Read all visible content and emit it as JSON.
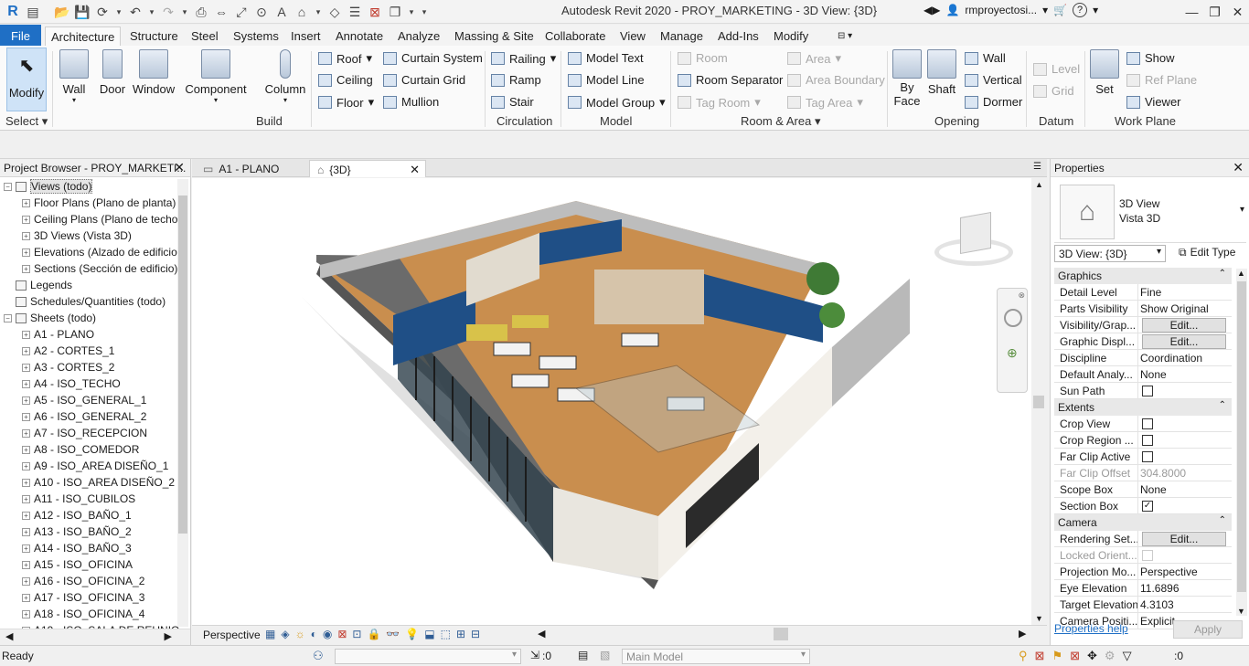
{
  "app": {
    "title": "Autodesk Revit 2020 - PROY_MARKETING - 3D View: {3D}",
    "user": "rmproyectosi...",
    "help": "?"
  },
  "ribbon_tabs": [
    "File",
    "Architecture",
    "Structure",
    "Steel",
    "Systems",
    "Insert",
    "Annotate",
    "Analyze",
    "Massing & Site",
    "Collaborate",
    "View",
    "Manage",
    "Add-Ins",
    "Modify"
  ],
  "ribbon": {
    "modify": "Modify",
    "select": "Select",
    "build": {
      "label": "Build",
      "wall": "Wall",
      "door": "Door",
      "window": "Window",
      "component": "Component",
      "column": "Column",
      "roof": "Roof",
      "ceiling": "Ceiling",
      "floor": "Floor",
      "curtain_system": "Curtain System",
      "curtain_grid": "Curtain Grid",
      "mullion": "Mullion"
    },
    "circulation": {
      "label": "Circulation",
      "railing": "Railing",
      "ramp": "Ramp",
      "stair": "Stair"
    },
    "model": {
      "label": "Model",
      "model_text": "Model Text",
      "model_line": "Model Line",
      "model_group": "Model Group"
    },
    "room_area": {
      "label": "Room & Area",
      "room": "Room",
      "room_separator": "Room Separator",
      "tag_room": "Tag Room",
      "area": "Area",
      "area_boundary": "Area Boundary",
      "tag_area": "Tag Area"
    },
    "opening": {
      "label": "Opening",
      "by_face_1": "By",
      "by_face_2": "Face",
      "shaft": "Shaft",
      "wall": "Wall",
      "vertical": "Vertical",
      "dormer": "Dormer"
    },
    "datum": {
      "label": "Datum",
      "level": "Level",
      "grid": "Grid"
    },
    "work_plane": {
      "label": "Work Plane",
      "set": "Set",
      "show": "Show",
      "ref_plane": "Ref Plane",
      "viewer": "Viewer"
    }
  },
  "project_browser": {
    "title": "Project Browser - PROY_MARKETI...",
    "items": [
      {
        "label": "Views (todo)",
        "level": 0,
        "expanded": true
      },
      {
        "label": "Floor Plans (Plano de planta)",
        "level": 1
      },
      {
        "label": "Ceiling Plans (Plano de techo)",
        "level": 1
      },
      {
        "label": "3D Views (Vista 3D)",
        "level": 1
      },
      {
        "label": "Elevations (Alzado de edificio)",
        "level": 1
      },
      {
        "label": "Sections (Sección de edificio)",
        "level": 1
      },
      {
        "label": "Legends",
        "level": 0,
        "leaf": true
      },
      {
        "label": "Schedules/Quantities (todo)",
        "level": 0,
        "leaf": true
      },
      {
        "label": "Sheets (todo)",
        "level": 0,
        "expanded": true
      },
      {
        "label": "A1 - PLANO",
        "level": 1
      },
      {
        "label": "A2 - CORTES_1",
        "level": 1
      },
      {
        "label": "A3 - CORTES_2",
        "level": 1
      },
      {
        "label": "A4 - ISO_TECHO",
        "level": 1
      },
      {
        "label": "A5 - ISO_GENERAL_1",
        "level": 1
      },
      {
        "label": "A6 - ISO_GENERAL_2",
        "level": 1
      },
      {
        "label": "A7 - ISO_RECEPCION",
        "level": 1
      },
      {
        "label": "A8 - ISO_COMEDOR",
        "level": 1
      },
      {
        "label": "A9 - ISO_AREA DISEÑO_1",
        "level": 1
      },
      {
        "label": "A10 - ISO_AREA DISEÑO_2",
        "level": 1
      },
      {
        "label": "A11 - ISO_CUBILOS",
        "level": 1
      },
      {
        "label": "A12 - ISO_BAÑO_1",
        "level": 1
      },
      {
        "label": "A13 - ISO_BAÑO_2",
        "level": 1
      },
      {
        "label": "A14 - ISO_BAÑO_3",
        "level": 1
      },
      {
        "label": "A15 - ISO_OFICINA",
        "level": 1
      },
      {
        "label": "A16 - ISO_OFICINA_2",
        "level": 1
      },
      {
        "label": "A17 - ISO_OFICINA_3",
        "level": 1
      },
      {
        "label": "A18 - ISO_OFICINA_4",
        "level": 1
      },
      {
        "label": "A19 - ISO_SALA DE REUNIO",
        "level": 1
      }
    ]
  },
  "view_tabs": [
    {
      "label": "A1 - PLANO"
    },
    {
      "label": "{3D}"
    }
  ],
  "view_control": {
    "mode": "Perspective"
  },
  "properties": {
    "title": "Properties",
    "type_name_1": "3D View",
    "type_name_2": "Vista 3D",
    "selector": "3D View: {3D}",
    "edit_type": "Edit Type",
    "groups": [
      {
        "name": "Graphics",
        "rows": [
          {
            "k": "Detail Level",
            "v": "Fine"
          },
          {
            "k": "Parts Visibility",
            "v": "Show Original"
          },
          {
            "k": "Visibility/Grap...",
            "btn": "Edit..."
          },
          {
            "k": "Graphic Displ...",
            "btn": "Edit..."
          },
          {
            "k": "Discipline",
            "v": "Coordination"
          },
          {
            "k": "Default Analy...",
            "v": "None"
          },
          {
            "k": "Sun Path",
            "chk": false
          }
        ]
      },
      {
        "name": "Extents",
        "rows": [
          {
            "k": "Crop View",
            "chk": false
          },
          {
            "k": "Crop Region ...",
            "chk": false
          },
          {
            "k": "Far Clip Active",
            "chk": false
          },
          {
            "k": "Far Clip Offset",
            "v": "304.8000",
            "grey": true
          },
          {
            "k": "Scope Box",
            "v": "None"
          },
          {
            "k": "Section Box",
            "chk": true
          }
        ]
      },
      {
        "name": "Camera",
        "rows": [
          {
            "k": "Rendering Set...",
            "btn": "Edit..."
          },
          {
            "k": "Locked Orient...",
            "chk": false,
            "grey": true
          },
          {
            "k": "Projection Mo...",
            "v": "Perspective"
          },
          {
            "k": "Eye Elevation",
            "v": "11.6896"
          },
          {
            "k": "Target Elevation",
            "v": "4.3103"
          },
          {
            "k": "Camera Positi...",
            "v": "Explicit"
          }
        ]
      }
    ],
    "help": "Properties help",
    "apply": "Apply"
  },
  "status": {
    "text": "Ready",
    "count1": ":0",
    "model": "Main Model",
    "count2": ":0"
  },
  "colors": {
    "file_tab": "#1f6fc5",
    "modify_active": "#cfe3f7",
    "wall_blue": "#1f4f86",
    "floor_wood": "#c98e4e"
  }
}
